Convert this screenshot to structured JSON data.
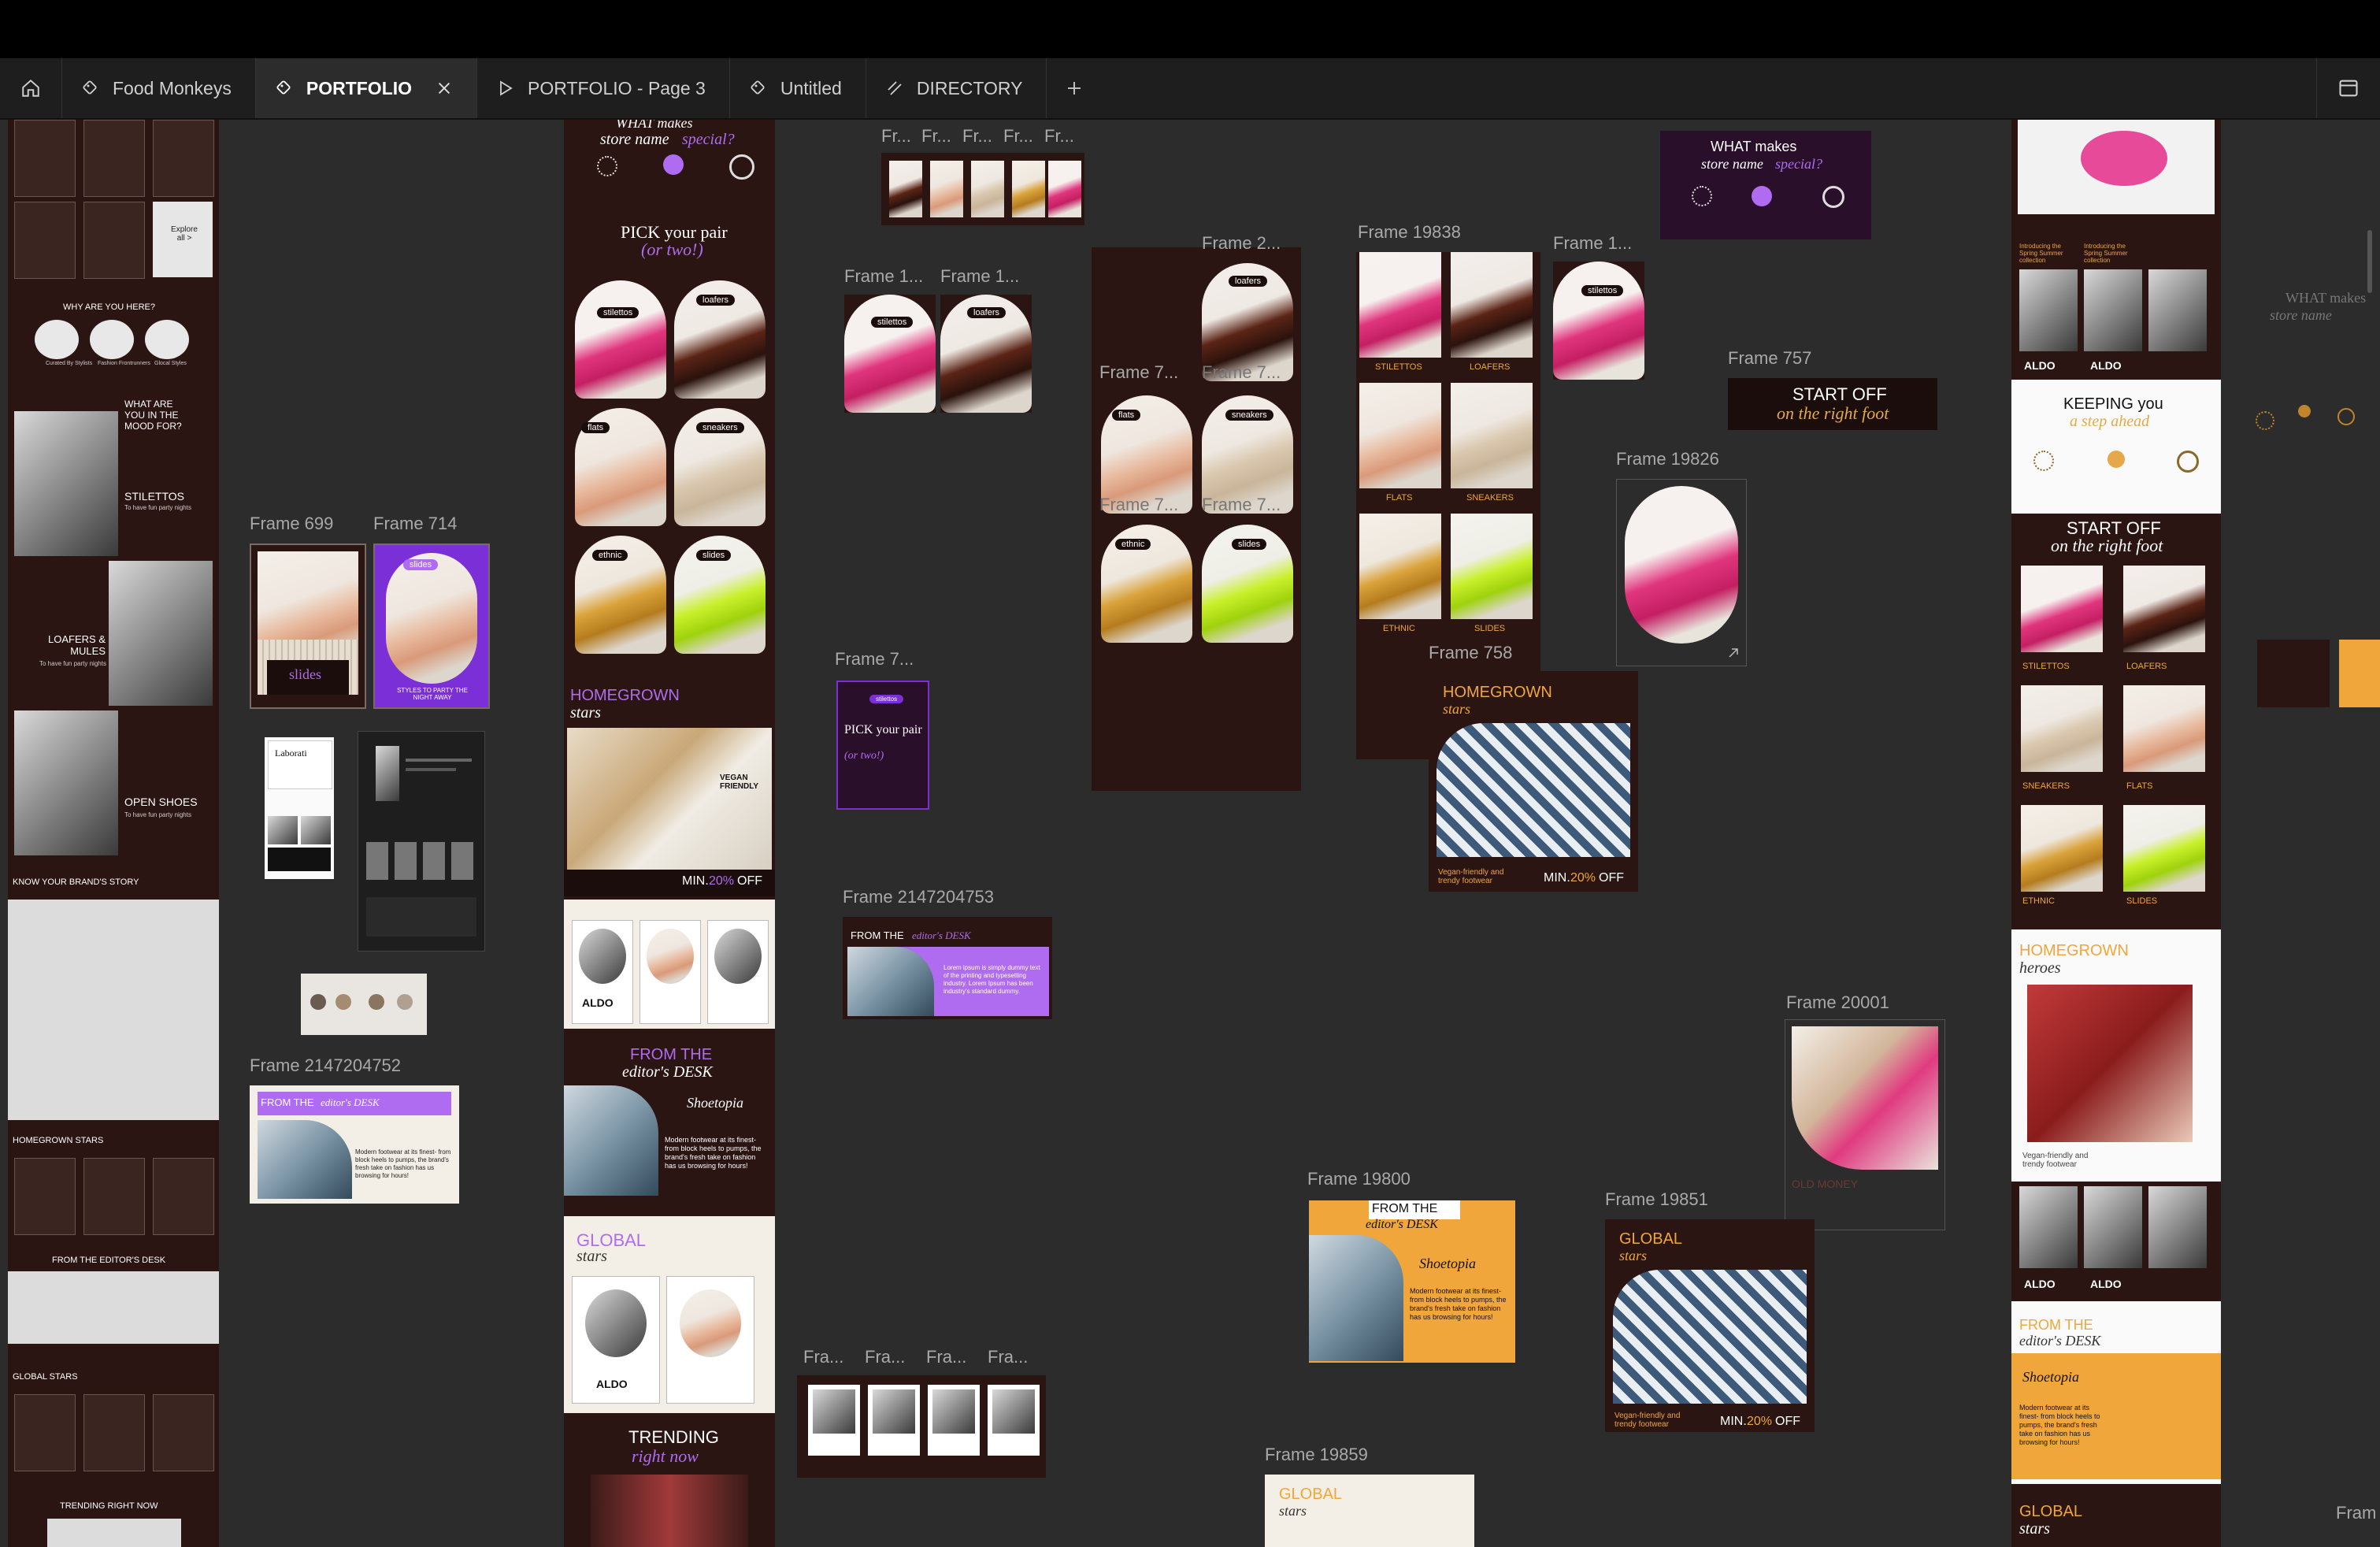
{
  "tabs": [
    {
      "label": "Food Monkeys",
      "icon": "component-icon"
    },
    {
      "label": "PORTFOLIO",
      "icon": "component-icon",
      "active": true
    },
    {
      "label": "PORTFOLIO - Page 3",
      "icon": "play-icon"
    },
    {
      "label": "Untitled",
      "icon": "component-icon"
    },
    {
      "label": "DIRECTORY",
      "icon": "slash-icon"
    }
  ],
  "labels": {
    "f699": "Frame 699",
    "f714": "Frame 714",
    "f2147204752": "Frame 2147204752",
    "fr_a": "Fr...",
    "fr_b": "Fr...",
    "fr_c": "Fr...",
    "fr_d": "Fr...",
    "fr_e": "Fr...",
    "frame1a": "Frame 1...",
    "frame1b": "Frame 1...",
    "frame7a": "Frame 7...",
    "f2147204753": "Frame 2147204753",
    "fra_a": "Fra...",
    "fra_b": "Fra...",
    "fra_c": "Fra...",
    "fra_d": "Fra...",
    "frame2": "Frame 2...",
    "frame7b": "Frame 7...",
    "frame7c": "Frame 7...",
    "frame7d": "Frame 7...",
    "frame7e": "Frame 7...",
    "f19838": "Frame 19838",
    "frame1c": "Frame 1...",
    "f757": "Frame 757",
    "f19826": "Frame 19826",
    "f758": "Frame 758",
    "f20001": "Frame 20001",
    "f19800": "Frame 19800",
    "f19851": "Frame 19851",
    "f19859": "Frame 19859",
    "fram_right": "Fram"
  },
  "content": {
    "why_here": "WHY ARE YOU HERE?",
    "curated": "Curated By Stylists",
    "fashion": "Fashion Frontrunners",
    "glocal": "Glocal Styles",
    "what_mood": "WHAT ARE YOU IN THE MOOD FOR?",
    "stilettos": "STILETTOS",
    "loafers_mules": "LOAFERS & MULES",
    "open_shoes": "OPEN SHOES",
    "fun_party": "To have fun party nights",
    "know_story": "KNOW YOUR BRAND'S STORY",
    "homegrown_stars_caps": "HOMEGROWN STARS",
    "from_editors": "FROM THE EDITOR'S DESK",
    "global_stars_caps": "GLOBAL STARS",
    "trending_caps": "TRENDING RIGHT NOW",
    "explore": "Explore all >",
    "what_makes": "WHAT makes",
    "store_name": "store name",
    "special": "special?",
    "pick_your_pair": "PICK your pair",
    "or_two": "(or two!)",
    "pill_stilettos": "stilettos",
    "pill_loafers": "loafers",
    "pill_flats": "flats",
    "pill_sneakers": "sneakers",
    "pill_ethnic": "ethnic",
    "pill_slides": "slides",
    "homegrown": "HOMEGROWN",
    "stars": "stars",
    "vegan": "VEGAN FRIENDLY",
    "min": "MIN.",
    "pct": "20%",
    "off": "OFF",
    "aldo": "ALDO",
    "from_the": "FROM THE",
    "editors_desk": "editor's DESK",
    "quote": "Modern footwear at its finest- from block heels to pumps, the brand's fresh take on fashion has us browsing for hours!",
    "global": "GLOBAL",
    "trending": "TRENDING",
    "right_now": "right now",
    "slides_label": "slides",
    "styles_party": "STYLES TO PARTY THE NIGHT AWAY",
    "start_off": "START OFF",
    "right_foot": "on the right foot",
    "keeping_you": "KEEPING you",
    "step_ahead": "a step ahead",
    "heroes": "heroes",
    "vegan_trendy": "Vegan-friendly and trendy footwear",
    "flats_caps": "FLATS",
    "sneakers_caps": "SNEAKERS",
    "ethnic_caps": "ETHNIC",
    "slides_caps": "SLIDES",
    "loafers_caps": "LOAFERS",
    "stilettos_caps": "STILETTOS",
    "old_money": "OLD MONEY",
    "lorem": "Lorem ipsum is simply dummy text of the printing and typesetting industry. Lorem Ipsum has been industry's standard dummy.",
    "shoetopia": "Shoetopia",
    "intro_spring": "Introducing the Spring Summer collection"
  }
}
